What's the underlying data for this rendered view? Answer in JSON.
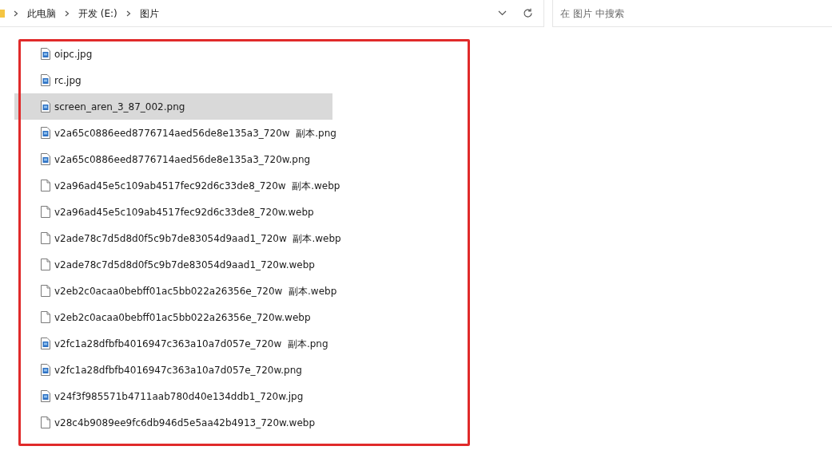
{
  "address_bar": {
    "crumbs": [
      "此电脑",
      "开发 (E:)",
      "图片"
    ]
  },
  "search": {
    "placeholder": "在 图片 中搜索"
  },
  "files": [
    {
      "name": "oipc.jpg",
      "kind": "image",
      "selected": false
    },
    {
      "name": "rc.jpg",
      "kind": "image",
      "selected": false
    },
    {
      "name": "screen_aren_3_87_002.png",
      "kind": "image",
      "selected": true
    },
    {
      "name": "v2a65c0886eed8776714aed56de8e135a3_720w  副本.png",
      "kind": "image",
      "selected": false
    },
    {
      "name": "v2a65c0886eed8776714aed56de8e135a3_720w.png",
      "kind": "image",
      "selected": false
    },
    {
      "name": "v2a96ad45e5c109ab4517fec92d6c33de8_720w  副本.webp",
      "kind": "blank",
      "selected": false
    },
    {
      "name": "v2a96ad45e5c109ab4517fec92d6c33de8_720w.webp",
      "kind": "blank",
      "selected": false
    },
    {
      "name": "v2ade78c7d5d8d0f5c9b7de83054d9aad1_720w  副本.webp",
      "kind": "blank",
      "selected": false
    },
    {
      "name": "v2ade78c7d5d8d0f5c9b7de83054d9aad1_720w.webp",
      "kind": "blank",
      "selected": false
    },
    {
      "name": "v2eb2c0acaa0bebff01ac5bb022a26356e_720w  副本.webp",
      "kind": "blank",
      "selected": false
    },
    {
      "name": "v2eb2c0acaa0bebff01ac5bb022a26356e_720w.webp",
      "kind": "blank",
      "selected": false
    },
    {
      "name": "v2fc1a28dfbfb4016947c363a10a7d057e_720w  副本.png",
      "kind": "image",
      "selected": false
    },
    {
      "name": "v2fc1a28dfbfb4016947c363a10a7d057e_720w.png",
      "kind": "image",
      "selected": false
    },
    {
      "name": "v24f3f985571b4711aab780d40e134ddb1_720w.jpg",
      "kind": "image",
      "selected": false
    },
    {
      "name": "v28c4b9089ee9fc6db946d5e5aa42b4913_720w.webp",
      "kind": "blank",
      "selected": false
    }
  ]
}
